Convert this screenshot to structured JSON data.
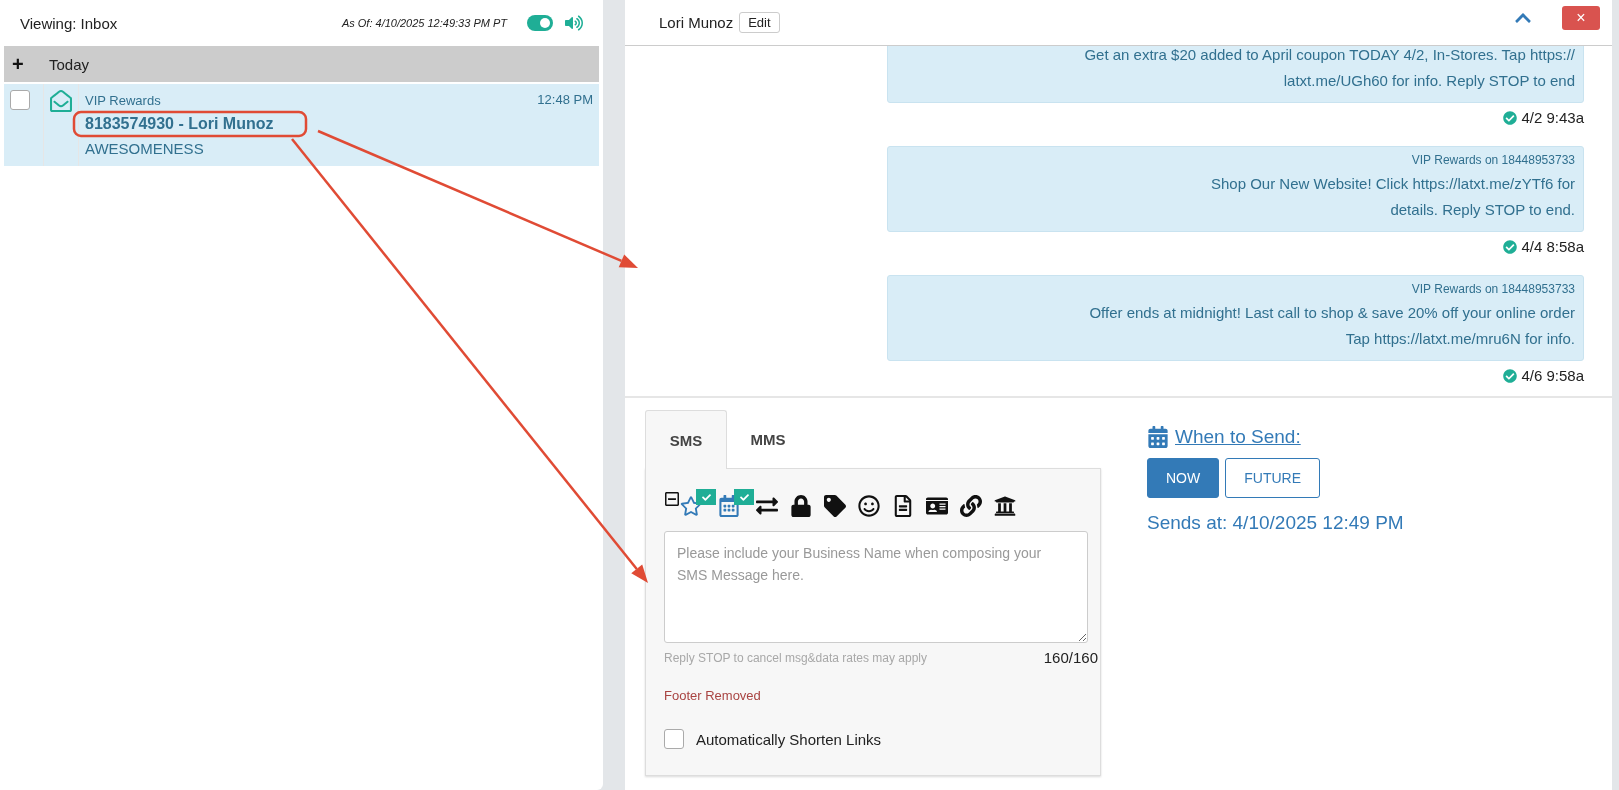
{
  "inbox": {
    "title": "Viewing: Inbox",
    "as_of": "As Of: 4/10/2025 12:49:33 PM PT",
    "live_updates": {
      "on": true
    },
    "groups": [
      {
        "toggle": "+",
        "label": "Today",
        "rows": [
          {
            "checked": false,
            "selected": true,
            "highlighted": true,
            "sender": "VIP Rewards",
            "contact": "8183574930 - Lori Munoz",
            "preview": "AWESOMENESS",
            "time": "12:48 PM"
          }
        ]
      }
    ]
  },
  "conversation": {
    "contact": "Lori Munoz",
    "edit_label": "Edit",
    "close_label": "×",
    "messages": [
      {
        "lines": [
          "Get an extra $20 added to April coupon TODAY 4/2, In-Stores. Tap https://",
          "latxt.me/UGh60 for info. Reply STOP to end"
        ],
        "delivered": true,
        "time": "4/2 9:43a"
      },
      {
        "sender": "VIP Rewards on 18448953733",
        "lines": [
          "Shop Our New Website! Click https://latxt.me/zYTf6 for",
          "details. Reply STOP to end."
        ],
        "delivered": true,
        "time": "4/4 8:58a"
      },
      {
        "sender": "VIP Rewards on 18448953733",
        "lines": [
          "Offer ends at midnight! Last call to shop & save 20% off your online order",
          "Tap https://latxt.me/mru6N for info."
        ],
        "delivered": true,
        "time": "4/6 9:58a"
      }
    ]
  },
  "compose": {
    "tabs": [
      {
        "label": "SMS",
        "selected": true
      },
      {
        "label": "MMS",
        "selected": false
      }
    ],
    "placeholder": "Please include your Business Name when composing your SMS Message here.",
    "footer_hint": "Reply STOP to cancel msg&data rates may apply",
    "counter": "160/160",
    "footer_status": "Footer Removed",
    "shorten_links": {
      "label": "Automatically Shorten Links",
      "checked": false
    }
  },
  "schedule": {
    "title": "When to Send:",
    "options": [
      {
        "label": "NOW",
        "selected": true
      },
      {
        "label": "FUTURE",
        "selected": false
      }
    ],
    "sends_at": "Sends at: 4/10/2025 12:49 PM"
  }
}
